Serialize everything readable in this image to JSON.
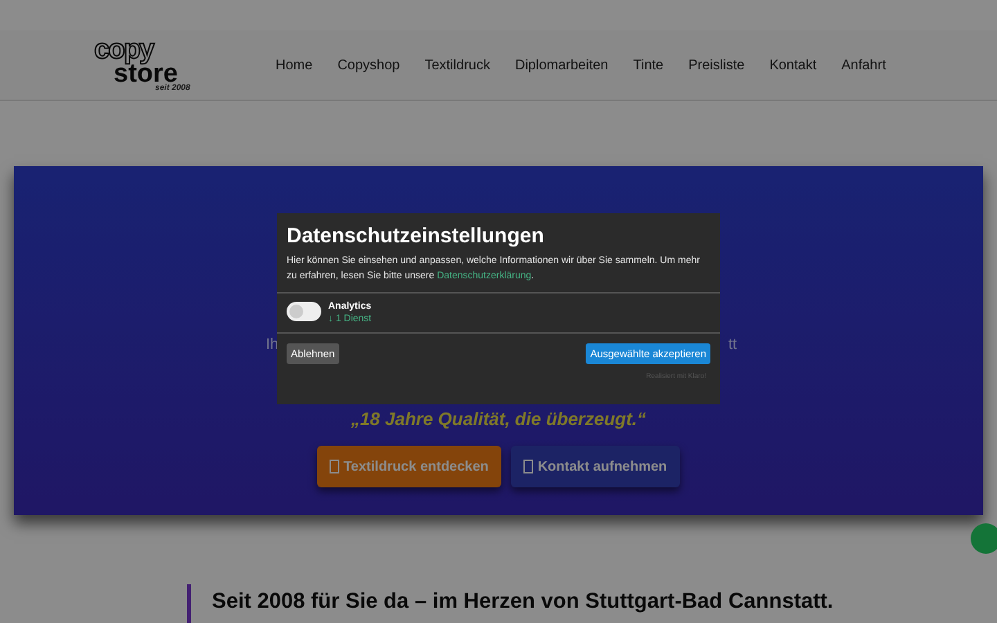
{
  "header": {
    "logo": {
      "word_top": "copy",
      "word_bottom": "store",
      "since": "seit 2008"
    },
    "nav": [
      "Home",
      "Copyshop",
      "Textildruck",
      "Diplomarbeiten",
      "Tinte",
      "Preisliste",
      "Kontakt",
      "Anfahrt"
    ]
  },
  "hero": {
    "text_left_fragment": "Ih",
    "text_right_fragment": "tt",
    "quote": "„18 Jahre Qualität, die überzeugt.“",
    "buttons": [
      {
        "label": "Textildruck entdecken",
        "kind": "primary"
      },
      {
        "label": "Kontakt aufnehmen",
        "kind": "secondary"
      }
    ]
  },
  "section": {
    "heading": "Seit 2008 für Sie da – im Herzen von Stuttgart-Bad Cannstatt."
  },
  "consent": {
    "title": "Datenschutzeinstellungen",
    "intro": "Hier können Sie einsehen und anpassen, welche Informationen wir über Sie sammeln. Um mehr zu erfahren, lesen Sie bitte unsere ",
    "link": "Datenschutzerklärung",
    "intro_end": ".",
    "services": [
      {
        "name": "Analytics",
        "count": "↓ 1 Dienst",
        "on": false
      }
    ],
    "decline": "Ablehnen",
    "accept": "Ausgewählte akzeptieren",
    "credit": "Realisiert mit Klaro!"
  }
}
